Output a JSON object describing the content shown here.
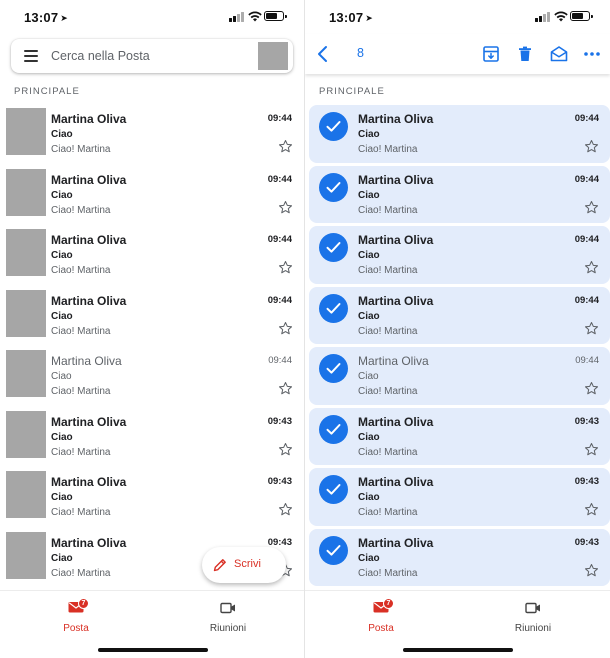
{
  "status_bar": {
    "time": "13:07",
    "location_glyph": "➤"
  },
  "search": {
    "placeholder": "Cerca nella Posta"
  },
  "selection": {
    "count": "8"
  },
  "section_label": "PRINCIPALE",
  "emails": [
    {
      "sender": "Martina Oliva",
      "subject": "Ciao",
      "snippet": "Ciao! Martina",
      "time": "09:44",
      "read": false
    },
    {
      "sender": "Martina Oliva",
      "subject": "Ciao",
      "snippet": "Ciao! Martina",
      "time": "09:44",
      "read": false
    },
    {
      "sender": "Martina Oliva",
      "subject": "Ciao",
      "snippet": "Ciao! Martina",
      "time": "09:44",
      "read": false
    },
    {
      "sender": "Martina Oliva",
      "subject": "Ciao",
      "snippet": "Ciao! Martina",
      "time": "09:44",
      "read": false
    },
    {
      "sender": "Martina Oliva",
      "subject": "Ciao",
      "snippet": "Ciao! Martina",
      "time": "09:44",
      "read": true
    },
    {
      "sender": "Martina Oliva",
      "subject": "Ciao",
      "snippet": "Ciao! Martina",
      "time": "09:43",
      "read": false
    },
    {
      "sender": "Martina Oliva",
      "subject": "Ciao",
      "snippet": "Ciao! Martina",
      "time": "09:43",
      "read": false
    },
    {
      "sender": "Martina Oliva",
      "subject": "Ciao",
      "snippet": "Ciao! Martina",
      "time": "09:43",
      "read": false
    }
  ],
  "fab": {
    "label": "Scrivi",
    "icon": "pencil-icon"
  },
  "bottom_nav": {
    "mail_label": "Posta",
    "mail_badge": "7",
    "meet_label": "Riunioni"
  },
  "icons": {
    "menu": "hamburger-menu-icon",
    "back": "chevron-left-icon",
    "archive": "archive-icon",
    "delete": "trash-icon",
    "mark_read": "open-envelope-icon",
    "more": "more-horizontal-icon",
    "star": "star-outline-icon",
    "check": "checkmark-icon",
    "video": "video-camera-icon"
  },
  "colors": {
    "accent_blue": "#1a73e8",
    "accent_red": "#d93025",
    "selected_row": "#e3ecfb",
    "avatar_placeholder": "#a6a6a6"
  }
}
